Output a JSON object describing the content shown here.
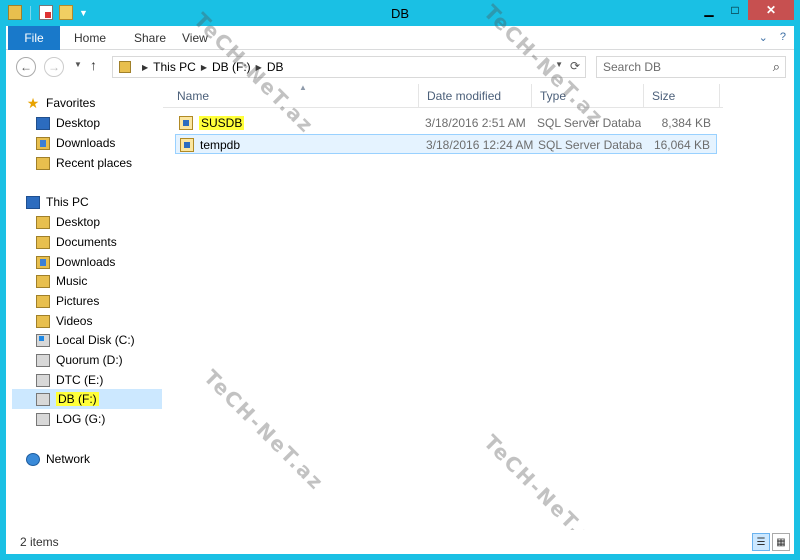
{
  "window": {
    "title": "DB",
    "colors": {
      "frame": "#1ac0e4",
      "file_tab": "#1979ca",
      "close": "#c75050",
      "highlight": "#ffff3a",
      "selection": "#cce8ff"
    }
  },
  "quick_access": {
    "icons": [
      "folder-icon",
      "properties-icon",
      "new-folder-icon",
      "customize-dropdown-icon"
    ]
  },
  "window_buttons": {
    "minimize": "▁",
    "maximize": "□",
    "close": "✕"
  },
  "ribbon": {
    "file_tab": "File",
    "tabs": [
      "Home",
      "Share",
      "View"
    ],
    "expand": "⌄",
    "help": "?"
  },
  "address_bar": {
    "crumbs": [
      "This PC",
      "DB (F:)",
      "DB"
    ]
  },
  "search": {
    "placeholder": "Search DB"
  },
  "nav": {
    "favorites_label": "Favorites",
    "favorites": [
      "Desktop",
      "Downloads",
      "Recent places"
    ],
    "this_pc_label": "This PC",
    "this_pc": [
      "Desktop",
      "Documents",
      "Downloads",
      "Music",
      "Pictures",
      "Videos",
      "Local Disk (C:)",
      "Quorum (D:)",
      "DTC (E:)",
      "DB (F:)",
      "LOG (G:)"
    ],
    "network_label": "Network",
    "selected": "DB (F:)"
  },
  "columns": [
    "Name",
    "Date modified",
    "Type",
    "Size"
  ],
  "files": [
    {
      "name": "SUSDB",
      "date": "3/18/2016 2:51 AM",
      "type": "SQL Server Databa...",
      "size": "8,384 KB",
      "highlighted": true
    },
    {
      "name": "tempdb",
      "date": "3/18/2016 12:24 AM",
      "type": "SQL Server Databa...",
      "size": "16,064 KB",
      "selected": true
    }
  ],
  "status": {
    "items": "2 items"
  },
  "watermark": "TeCH-NeT.az"
}
